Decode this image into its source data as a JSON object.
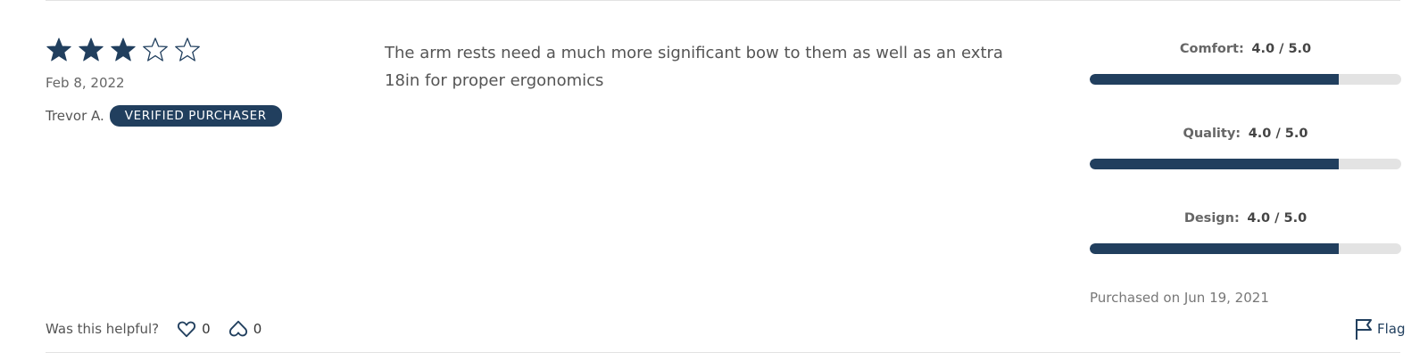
{
  "colors": {
    "accent": "#213f5e",
    "track": "#e3e3e3",
    "divider": "#e2e2e2"
  },
  "review": {
    "rating": 3,
    "max_rating": 5,
    "date": "Feb 8, 2022",
    "reviewer_name": "Trevor A.",
    "badge": "VERIFIED PURCHASER",
    "text": "The arm rests need a much more significant bow to them as well as an extra 18in for proper ergonomics"
  },
  "metrics": [
    {
      "name": "Comfort:",
      "value_text": "4.0 / 5.0",
      "value": 4.0,
      "max": 5.0
    },
    {
      "name": "Quality:",
      "value_text": "4.0 / 5.0",
      "value": 4.0,
      "max": 5.0
    },
    {
      "name": "Design:",
      "value_text": "4.0 / 5.0",
      "value": 4.0,
      "max": 5.0
    }
  ],
  "purchased": "Purchased on Jun 19, 2021",
  "helpful": {
    "question": "Was this helpful?",
    "up_count": "0",
    "down_count": "0",
    "up_icon": "heart-icon",
    "down_icon": "heart-down-icon"
  },
  "flag": {
    "label": "Flag",
    "icon": "flag-icon"
  }
}
